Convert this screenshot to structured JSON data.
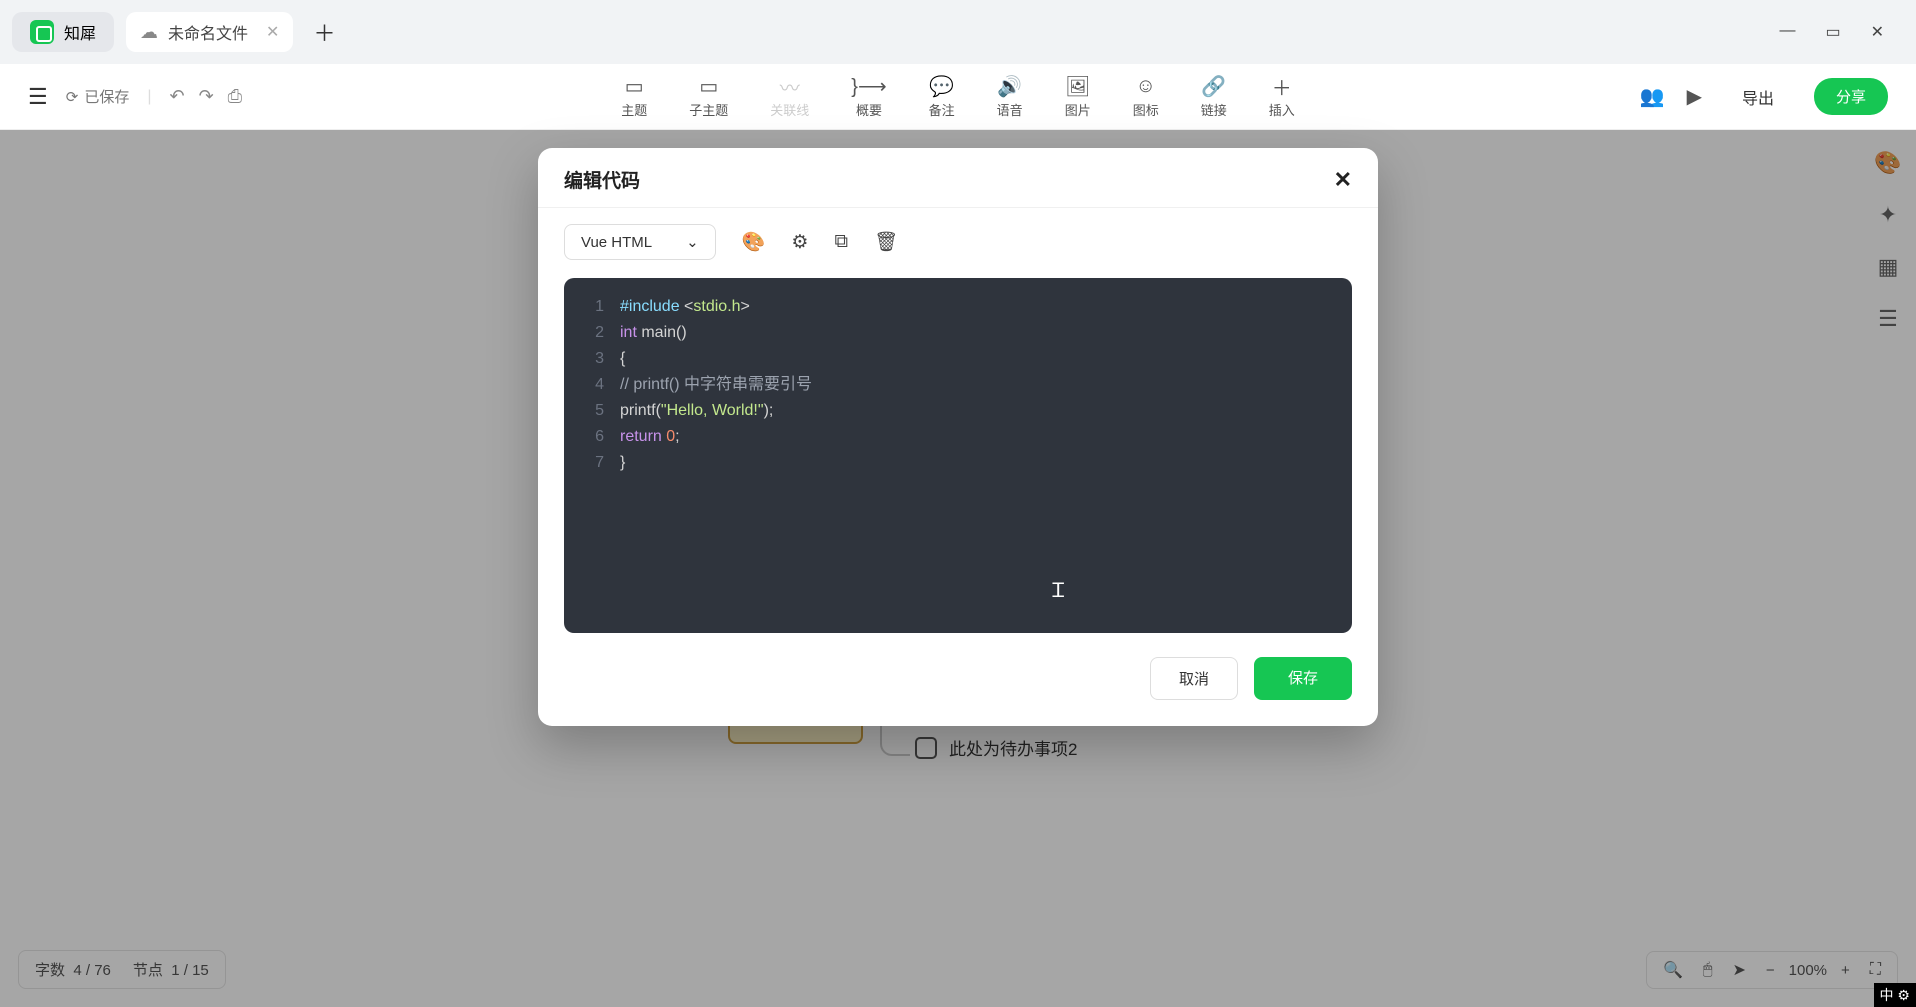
{
  "app": {
    "name": "知犀"
  },
  "tabs": {
    "file_name": "未命名文件"
  },
  "toolbar": {
    "save_status": "已保存",
    "tools": {
      "topic": "主题",
      "subtopic": "子主题",
      "relation": "关联线",
      "summary": "概要",
      "note": "备注",
      "audio": "语音",
      "image": "图片",
      "icon": "图标",
      "link": "链接",
      "insert": "插入"
    },
    "export": "导出",
    "share": "分享"
  },
  "mindmap": {
    "child_text": "此处为待办事项2"
  },
  "status": {
    "words_label": "字数",
    "words_value": "4 / 76",
    "nodes_label": "节点",
    "nodes_value": "1 / 15",
    "zoom": "100%"
  },
  "modal": {
    "title": "编辑代码",
    "language": "Vue HTML",
    "cancel": "取消",
    "save": "保存",
    "code": {
      "l1_a": "#include ",
      "l1_b": "<",
      "l1_c": "stdio.h",
      "l1_d": ">",
      "l2_a": "int",
      "l2_b": " main()",
      "l3": "{",
      "l4_a": "   // printf() ",
      "l4_b": "中字符串需要引号",
      "l5_a": "   printf(",
      "l5_b": "\"Hello, World!\"",
      "l5_c": ");",
      "l6_a": "   return ",
      "l6_b": "0",
      "l6_c": ";",
      "l7": "}"
    }
  },
  "ime": "中"
}
